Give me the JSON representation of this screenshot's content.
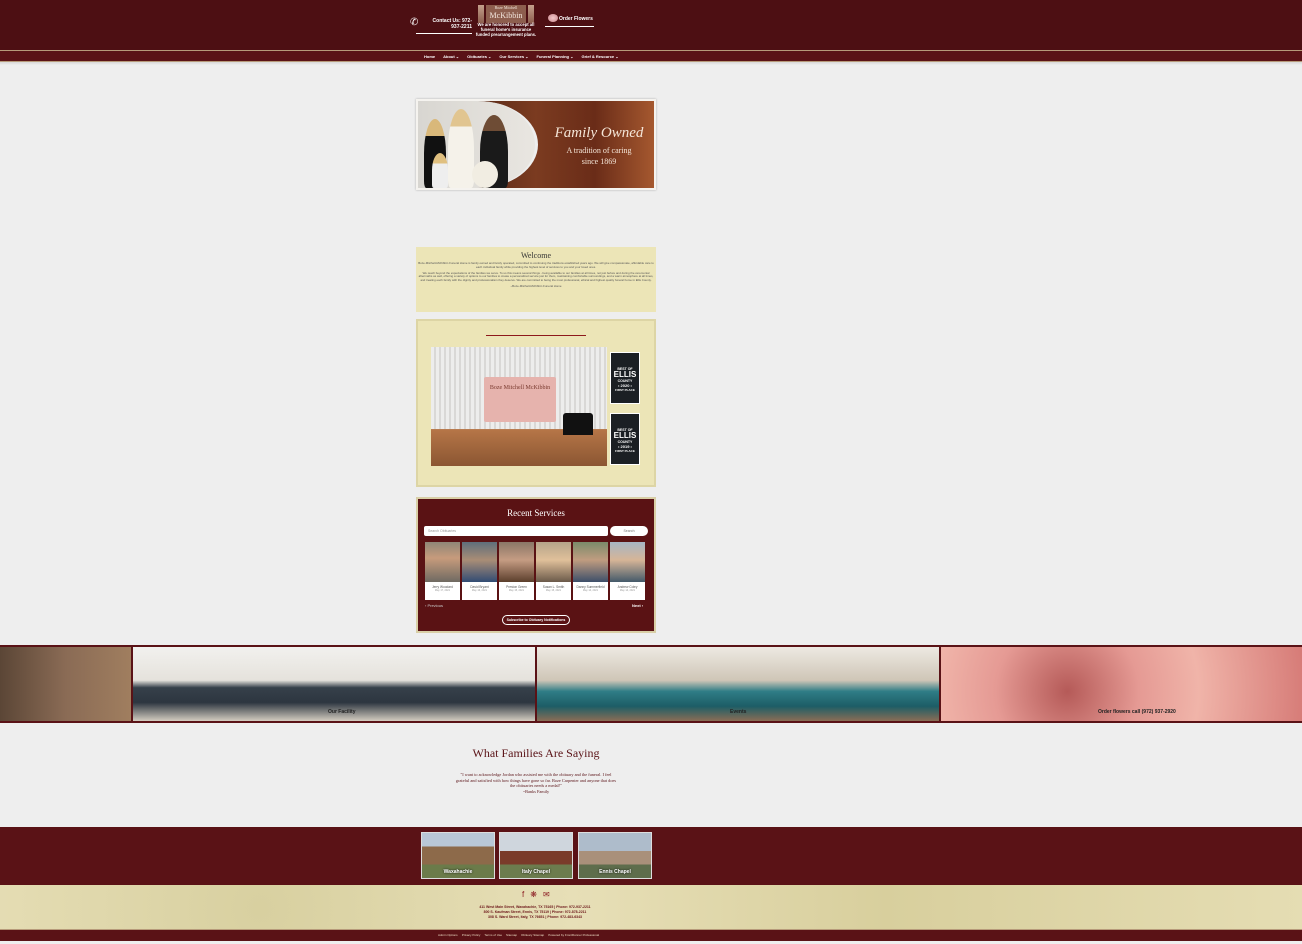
{
  "header": {
    "contact_text": "Contact Us: 972-937-2211",
    "logo_top": "Boze Mitchell",
    "logo_main": "McKibbin",
    "honored_text": "We are honored to accept all funeral home's insurance funded prearrangement plans.",
    "flowers_text": "Order Flowers"
  },
  "nav": {
    "items": [
      "Home",
      "About ⌄",
      "Obituaries ⌄",
      "Our Services ⌄",
      "Funeral Planning ⌄",
      "Grief & Resource ⌄"
    ]
  },
  "hero": {
    "headline": "Family Owned",
    "sub1": "A tradition of caring",
    "sub2": "since 1869"
  },
  "welcome": {
    "title": "Welcome",
    "p1": "Boze-Mitchell-McKibbin Funeral Home is family owned and family operated, committed to continuing the traditions established years ago. We will give compassionate, affordable care to each individual family while providing the highest level of services to you and your loved ones.",
    "p2": "We reach beyond the expectations of the families we serve. To us this means several things - being available to our families at all times, not just before and during the ceremonial aftermaths as well, offering a variety of options to our families to create a personalized service just for them, maintaining comfortable surroundings, and a warm atmosphere at all times, and treating each family with the dignity and professionalism they deserve. We are committed to being the most professional, ethical and highest quality funeral home in Ellis County.",
    "p3": "~Boze-Mitchell-McKibbin Funeral Home"
  },
  "chapel": {
    "sign_text": "Boze Mitchell McKibbin",
    "badges": [
      {
        "best": "BEST OF",
        "county": "ELLIS",
        "countylabel": "COUNTY",
        "year": "• 2020 •",
        "place": "FIRST PLACE"
      },
      {
        "best": "BEST OF",
        "county": "ELLIS",
        "countylabel": "COUNTY",
        "year": "• 2019 •",
        "place": "FIRST PLACE"
      }
    ]
  },
  "recent": {
    "title": "Recent Services",
    "search_placeholder": "Search Obituaries",
    "search_button": "Search",
    "obituaries": [
      {
        "name": "Jerry Woodard",
        "date": "May 17, 2021"
      },
      {
        "name": "David Bryant",
        "date": "May 16, 2021"
      },
      {
        "name": "Preston Green",
        "date": "May 15, 2021"
      },
      {
        "name": "Susan L. Smith",
        "date": "May 15, 2021"
      },
      {
        "name": "Danny Summerfield",
        "date": "May 14, 2021"
      },
      {
        "name": "Andrew Coley",
        "date": "May 14, 2021"
      }
    ],
    "prev": "‹  Previous",
    "next": "Next  ›",
    "subscribe": "Subscribe to Obituary Notifications"
  },
  "strip": {
    "labels": [
      "Our Facility",
      "Events",
      "Order flowers call (972) 937-2920"
    ]
  },
  "testimonials": {
    "title": "What Families Are Saying",
    "quote": "\"I want to acknowledge Jordan who assisted me with the obituary and the funeral. I feel grateful and satisfied with how things have gone so far. Boze Carpenter and anyone that does the obituaries needs a medal!\"",
    "author": "~Banks Family"
  },
  "locations": [
    "Waxahachie",
    "Italy Chapel",
    "Ennis Chapel"
  ],
  "footer": {
    "social_icons": [
      "facebook-icon",
      "yelp-icon",
      "mail-icon"
    ],
    "addr1": "411 West Main Street, Waxahachie, TX 75165 | Phone: 972-937-2211",
    "addr2": "800 S. Kaufman Street, Ennis, TX 75119 | Phone: 972-878-2211",
    "addr3": "308 S. Ward Street, Italy, TX 76651 | Phone: 972-483-6343",
    "links": [
      "Admin Options",
      "Privacy Policy",
      "Terms of Use",
      "Sitemap",
      "Obituary Sitemap",
      "Powered by FrontRunner Professional"
    ]
  },
  "colors": {
    "brand": "#4d0f13",
    "cream": "#ece5b7"
  }
}
